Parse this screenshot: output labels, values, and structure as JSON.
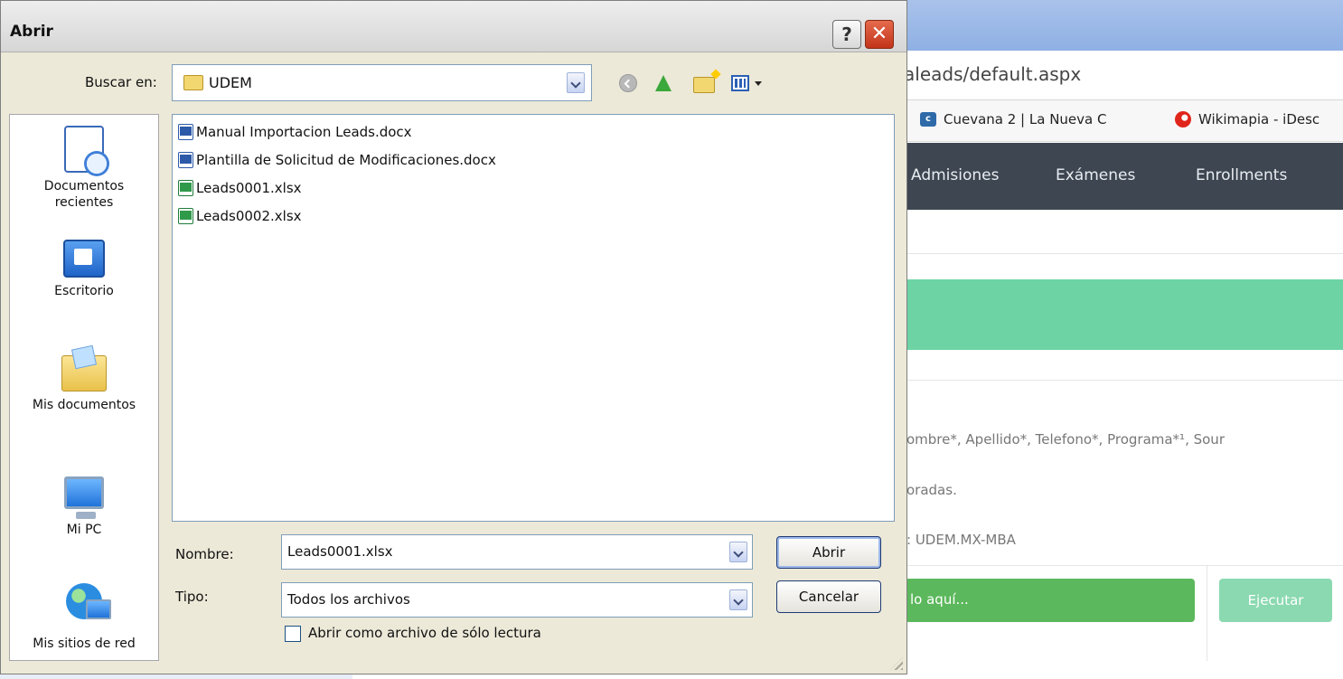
{
  "background_browser": {
    "url_fragment": "aleads/default.aspx",
    "bookmarks": [
      {
        "icon": "cuevana-favicon",
        "label": "Cuevana 2 | La Nueva C"
      },
      {
        "icon": "wikimapia-favicon",
        "label": "Wikimapia - iDesc"
      }
    ],
    "nav_items": [
      "Admisiones",
      "Exámenes",
      "Enrollments"
    ],
    "info_lines": [
      "ombre*, Apellido*, Telefono*, Programa*¹, Sour",
      "oradas.",
      ": UDEM.MX-MBA"
    ],
    "file_input_label": "lo aquí...",
    "execute_label": "Ejecutar"
  },
  "dialog": {
    "title": "Abrir",
    "help_button": "?",
    "close_button": "✕",
    "look_in_label": "Buscar en:",
    "look_in_value": "UDEM",
    "places": [
      {
        "icon": "recent-documents-icon",
        "label": "Documentos recientes"
      },
      {
        "icon": "desktop-icon",
        "label": "Escritorio"
      },
      {
        "icon": "my-documents-icon",
        "label": "Mis documentos"
      },
      {
        "icon": "my-computer-icon",
        "label": "Mi PC"
      },
      {
        "icon": "network-places-icon",
        "label": "Mis sitios de red"
      }
    ],
    "files": [
      {
        "icon": "word-doc-icon",
        "name": "Manual Importacion Leads.docx"
      },
      {
        "icon": "word-doc-icon",
        "name": "Plantilla de Solicitud de Modificaciones.docx"
      },
      {
        "icon": "excel-doc-icon",
        "name": "Leads0001.xlsx"
      },
      {
        "icon": "excel-doc-icon",
        "name": "Leads0002.xlsx"
      }
    ],
    "filename_label": "Nombre:",
    "filename_value": "Leads0001.xlsx",
    "filetype_label": "Tipo:",
    "filetype_value": "Todos los archivos",
    "open_button": "Abrir",
    "cancel_button": "Cancelar",
    "readonly_checkbox_label": "Abrir como archivo de sólo lectura",
    "readonly_checked": false
  },
  "colors": {
    "dialog_bg": "#ece9d8",
    "nav_bg": "#3d4651",
    "banner_green": "#6dd3a5",
    "button_green": "#5cb85c",
    "execute_green": "#8ad9b0",
    "close_red": "#c2341a"
  }
}
